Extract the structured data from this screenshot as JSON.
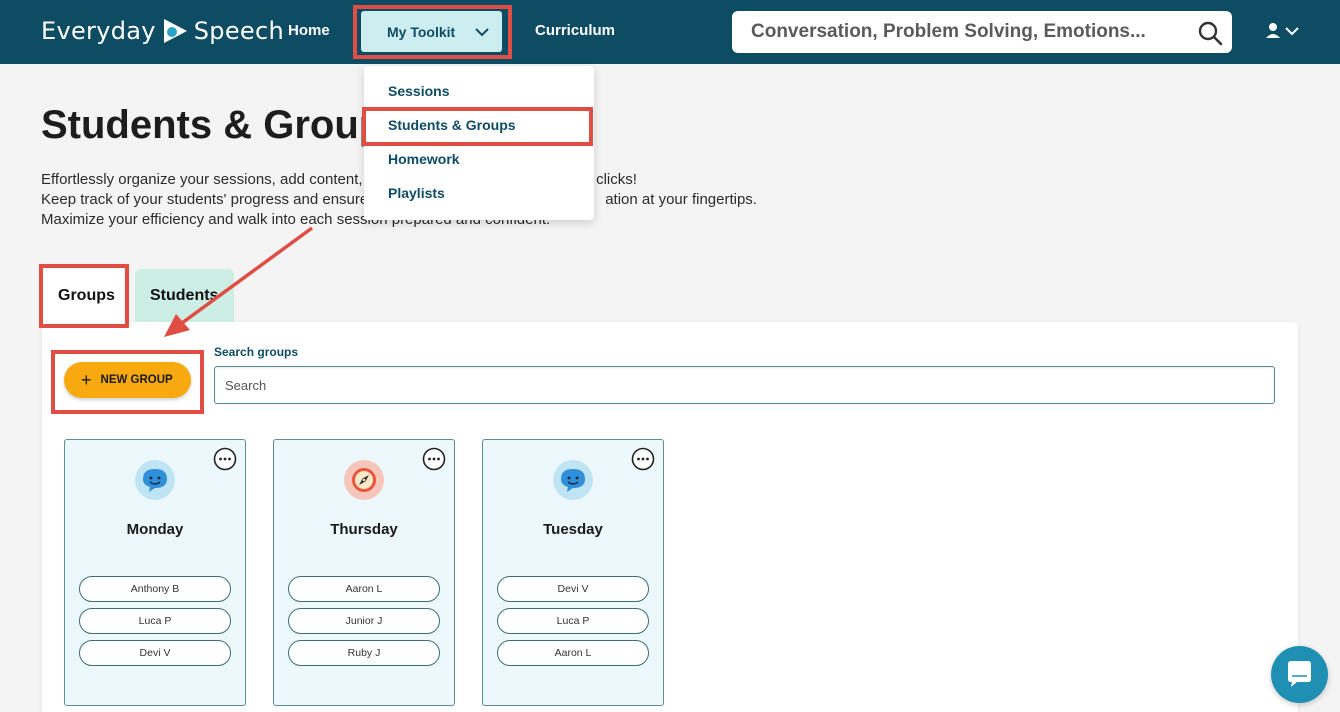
{
  "brand": {
    "name_left": "Everyday",
    "name_right": "Speech"
  },
  "nav": {
    "home": "Home",
    "toolkit": "My Toolkit",
    "curriculum": "Curriculum",
    "search_placeholder": "Conversation, Problem Solving, Emotions..."
  },
  "toolkit_menu": {
    "items": [
      "Sessions",
      "Students & Groups",
      "Homework",
      "Playlists"
    ]
  },
  "page": {
    "title": "Students & Groups",
    "intro_lines": [
      "Effortlessly organize your sessions, add content, a",
      "clicks!",
      "Keep track of your students' progress and ensure",
      "ation at your fingertips.",
      "Maximize your efficiency and walk into each session prepared and confident."
    ]
  },
  "tabs": {
    "groups": "Groups",
    "students": "Students"
  },
  "toolbar": {
    "new_group": "NEW GROUP",
    "search_label": "Search groups",
    "search_placeholder": "Search"
  },
  "groups": [
    {
      "name": "Monday",
      "icon": "chat-bubble-face-icon",
      "members": [
        "Anthony B",
        "Luca P",
        "Devi V"
      ]
    },
    {
      "name": "Thursday",
      "icon": "compass-icon",
      "members": [
        "Aaron L",
        "Junior J",
        "Ruby J"
      ]
    },
    {
      "name": "Tuesday",
      "icon": "chat-bubble-face-icon",
      "members": [
        "Devi V",
        "Luca P",
        "Aaron L"
      ]
    }
  ],
  "colors": {
    "header": "#0e4c64",
    "accent_button": "#f7a90f",
    "highlight": "#e04d43",
    "card_bg": "#ecf8fb"
  }
}
